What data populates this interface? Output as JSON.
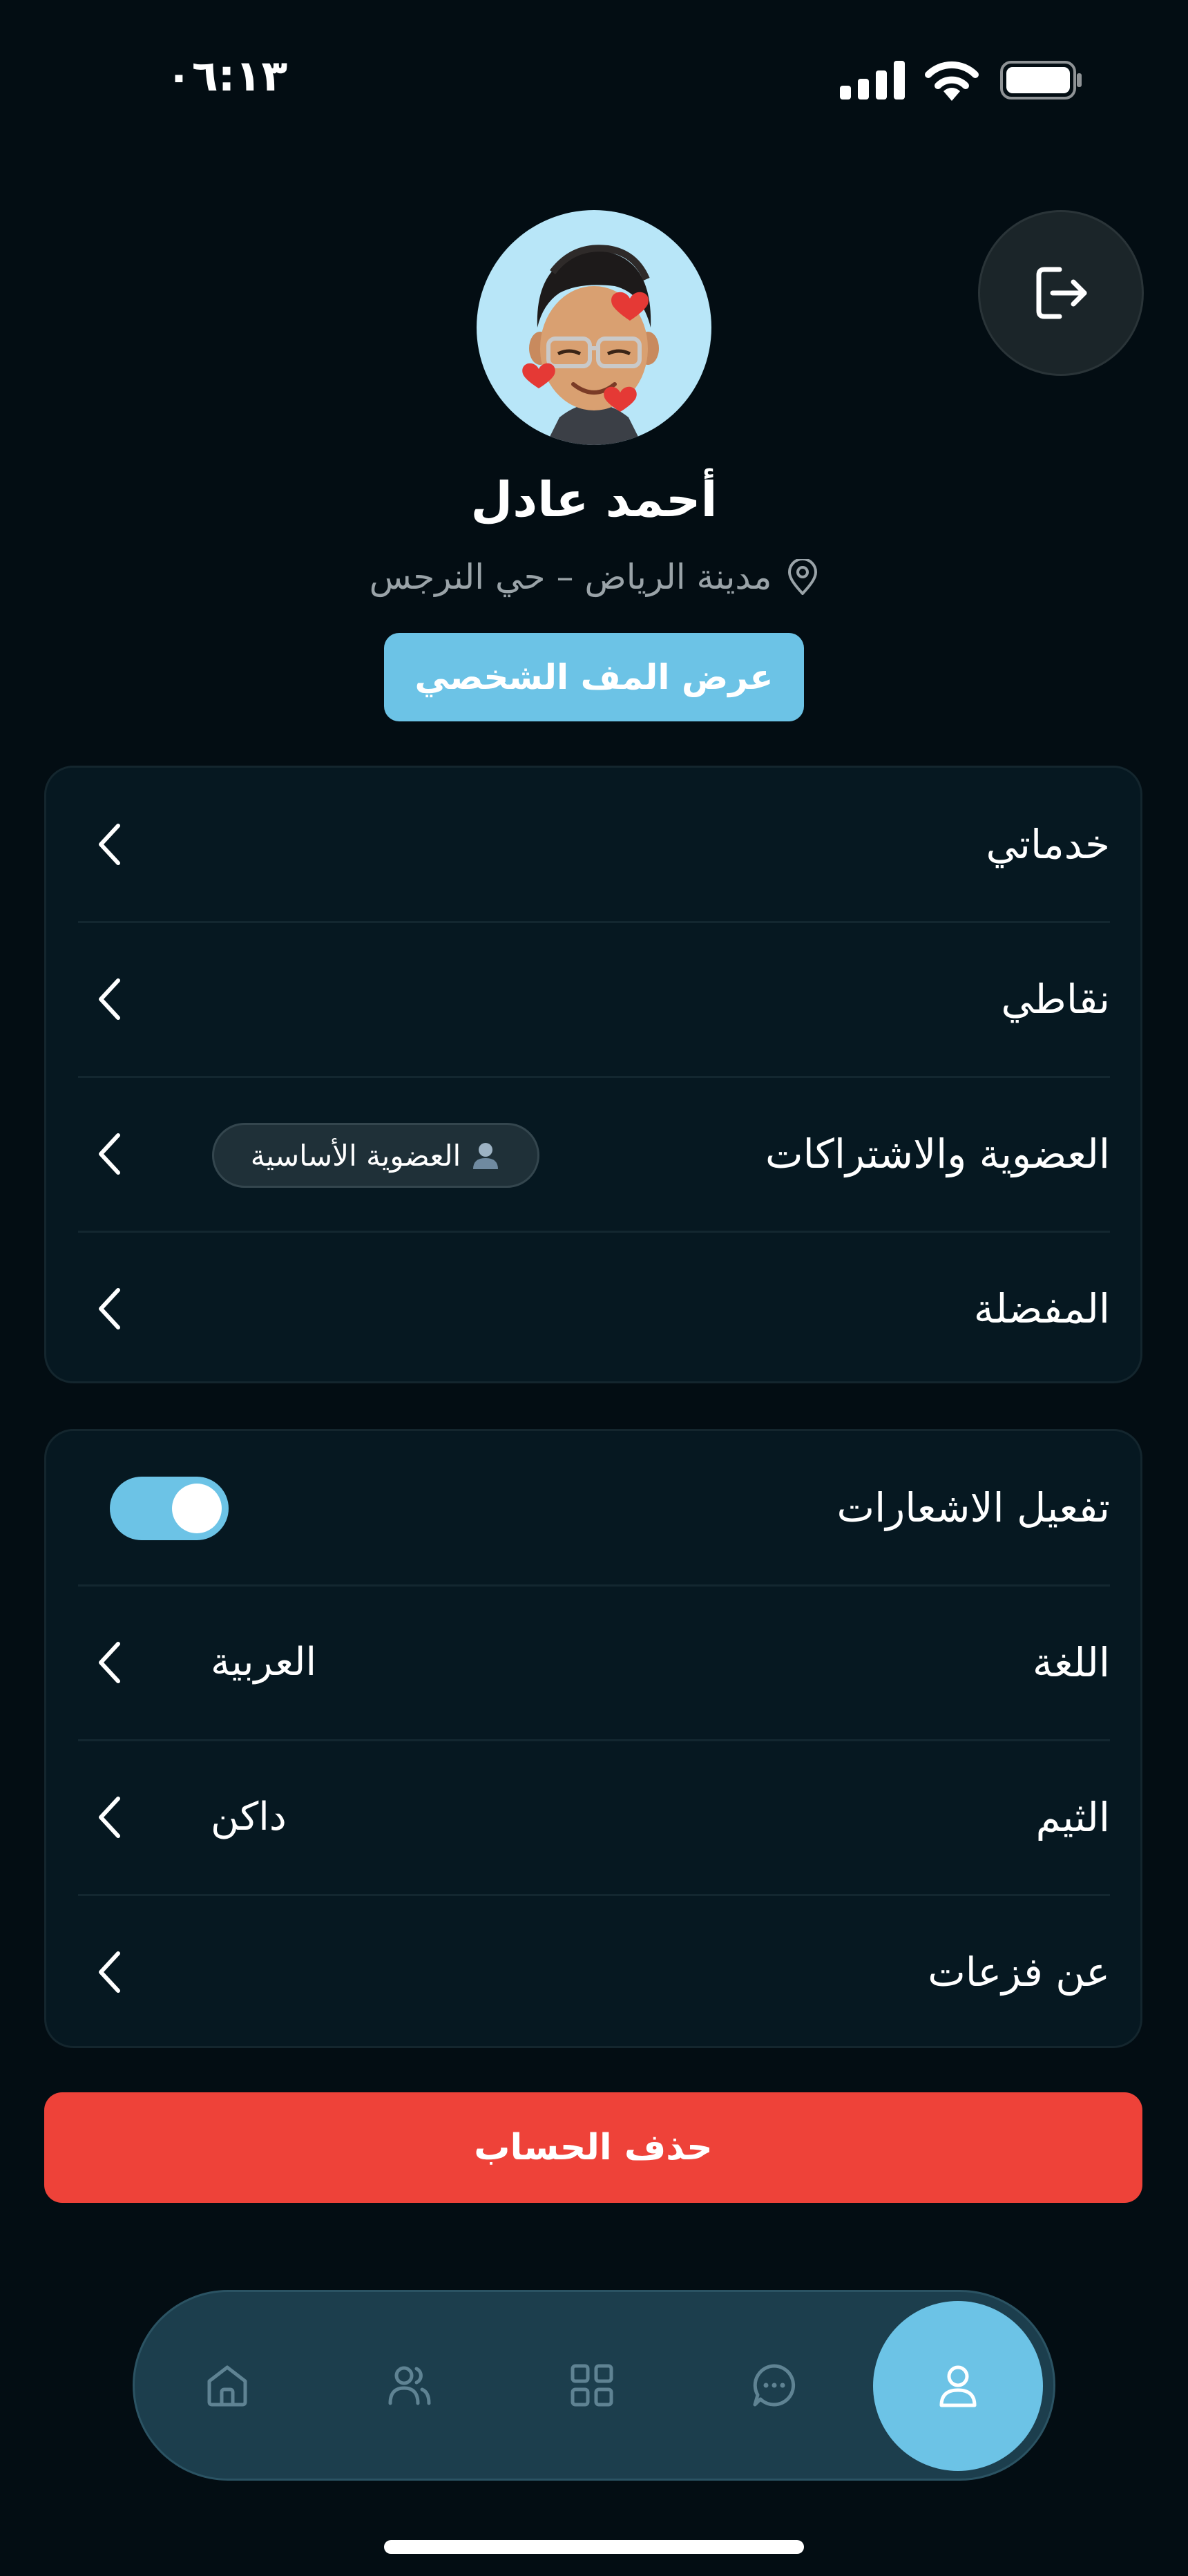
{
  "status_bar": {
    "time": "٠٦:١٣"
  },
  "profile": {
    "name": "أحمد عادل",
    "location": "مدينة الرياض – حي النرجس",
    "view_profile_label": "عرض المف الشخصي"
  },
  "menu_card": {
    "items": [
      {
        "label": "خدماتي"
      },
      {
        "label": "نقاطي"
      },
      {
        "label": "العضوية والاشتراكات",
        "badge": "العضوية الأساسية"
      },
      {
        "label": "المفضلة"
      }
    ]
  },
  "settings_card": {
    "notifications": {
      "label": "تفعيل الاشعارات",
      "enabled": true
    },
    "language": {
      "label": "اللغة",
      "value": "العربية"
    },
    "theme": {
      "label": "الثيم",
      "value": "داكن"
    },
    "about": {
      "label": "عن فزعات"
    }
  },
  "delete_account_label": "حذف الحساب",
  "bottom_nav": {
    "items": [
      {
        "icon": "home-icon"
      },
      {
        "icon": "users-icon"
      },
      {
        "icon": "grid-icon"
      },
      {
        "icon": "chat-icon"
      },
      {
        "icon": "profile-icon",
        "active": true
      }
    ]
  },
  "colors": {
    "background": "#030d13",
    "card": "#061821",
    "accent": "#6cc3e6",
    "danger": "#ee4239",
    "nav": "#1c3e4d"
  }
}
